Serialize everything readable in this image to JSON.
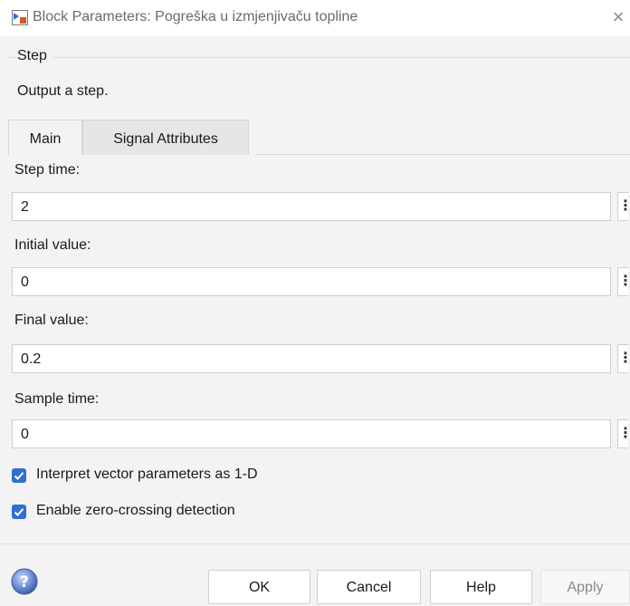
{
  "window": {
    "title": "Block Parameters: Pogreška u izmjenjivaču topline",
    "close_glyph": "×"
  },
  "group": {
    "name": "Step",
    "description": "Output a step."
  },
  "tabs": [
    {
      "label": "Main",
      "active": true
    },
    {
      "label": "Signal Attributes",
      "active": false
    }
  ],
  "params": [
    {
      "label": "Step time:",
      "value": "2"
    },
    {
      "label": "Initial value:",
      "value": "0"
    },
    {
      "label": "Final value:",
      "value": "0.2"
    },
    {
      "label": "Sample time:",
      "value": "0"
    }
  ],
  "more_glyph": "⋮",
  "checkboxes": [
    {
      "label": "Interpret vector parameters as 1-D",
      "checked": true
    },
    {
      "label": "Enable zero-crossing detection",
      "checked": true
    }
  ],
  "buttons": {
    "ok": "OK",
    "cancel": "Cancel",
    "help": "Help",
    "apply": "Apply"
  },
  "colors": {
    "accent": "#2f6fd1",
    "dialog_bg": "#f3f3f3"
  },
  "icons": {
    "app": "simulink-block-icon",
    "help": "help-question-icon",
    "close": "close-icon",
    "more": "more-options-icon",
    "check": "checkmark-icon"
  }
}
